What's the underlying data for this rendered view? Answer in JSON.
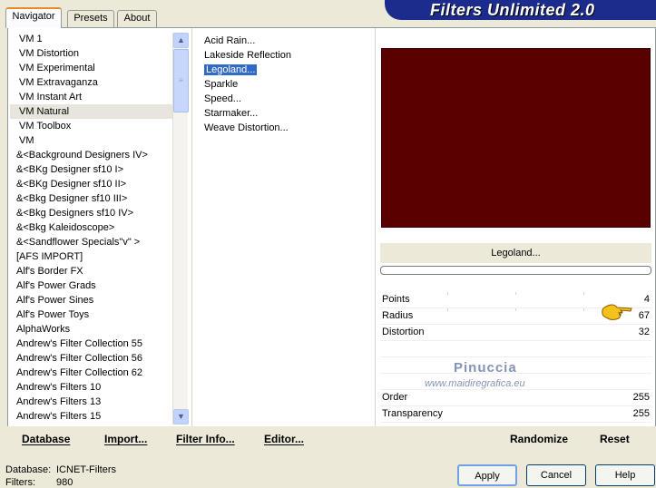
{
  "tabs": [
    {
      "label": "Navigator"
    },
    {
      "label": "Presets"
    },
    {
      "label": "About"
    }
  ],
  "banner": {
    "title": "Filters Unlimited 2.0"
  },
  "categories": [
    "VM 1",
    "VM Distortion",
    "VM Experimental",
    "VM Extravaganza",
    "VM Instant Art",
    "VM Natural",
    "VM Toolbox",
    "VM",
    "&<Background Designers IV>",
    "&<BKg Designer sf10 I>",
    "&<BKg Designer sf10 II>",
    "&<Bkg Designer sf10 III>",
    "&<Bkg Designers sf10 IV>",
    "&<Bkg Kaleidoscope>",
    "&<Sandflower Specials\"v\" >",
    "[AFS IMPORT]",
    "Alf's Border FX",
    "Alf's Power Grads",
    "Alf's Power Sines",
    "Alf's Power Toys",
    "AlphaWorks",
    "Andrew's Filter Collection 55",
    "Andrew's Filter Collection 56",
    "Andrew's Filter Collection 62",
    "Andrew's Filters 10",
    "Andrew's Filters 13",
    "Andrew's Filters 15"
  ],
  "filters": [
    "Acid Rain...",
    "Lakeside Reflection",
    "Legoland...",
    "Sparkle",
    "Speed...",
    "Starmaker...",
    "Weave Distortion..."
  ],
  "selected_filter_name": "Legoland...",
  "params": {
    "points": {
      "label": "Points",
      "value": "4"
    },
    "radius": {
      "label": "Radius",
      "value": "67"
    },
    "distortion": {
      "label": "Distortion",
      "value": "32"
    },
    "order": {
      "label": "Order",
      "value": "255"
    },
    "transparency": {
      "label": "Transparency",
      "value": "255"
    }
  },
  "watermark": {
    "name": "Pinuccia",
    "url": "www.maidiregrafica.eu"
  },
  "toolbar": {
    "database": "Database",
    "import": "Import...",
    "filter_info": "Filter Info...",
    "editor": "Editor...",
    "randomize": "Randomize",
    "reset": "Reset"
  },
  "status": {
    "database_label": "Database:",
    "database_value": "ICNET-Filters",
    "filters_label": "Filters:",
    "filters_value": "980"
  },
  "buttons": {
    "apply": "Apply",
    "cancel": "Cancel",
    "help": "Help"
  },
  "colors": {
    "preview": "#5a0000",
    "selection": "#316ac5",
    "banner": "#1c2c8c"
  }
}
